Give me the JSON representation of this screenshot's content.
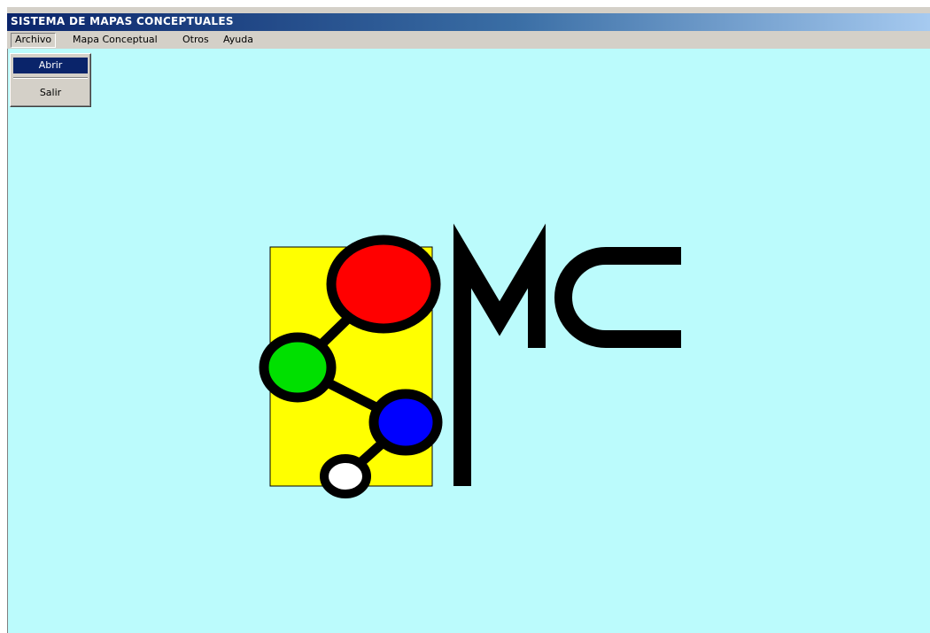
{
  "window": {
    "title": "SISTEMA DE MAPAS CONCEPTUALES"
  },
  "menubar": {
    "items": [
      {
        "label": "Archivo"
      },
      {
        "label": "Mapa Conceptual"
      },
      {
        "label": "Otros"
      },
      {
        "label": "Ayuda"
      }
    ]
  },
  "archivo_menu": {
    "items": [
      {
        "label": "Abrir",
        "selected": true
      },
      {
        "label": "Salir",
        "selected": false
      }
    ]
  },
  "logo": {
    "letters": "MC",
    "colors": {
      "background": "#bbfbfc",
      "panel": "#ffff00",
      "node_top": "#ff0000",
      "node_left": "#00e000",
      "node_right": "#0000ff",
      "node_bottom": "#ffffff",
      "stroke": "#000000"
    }
  }
}
